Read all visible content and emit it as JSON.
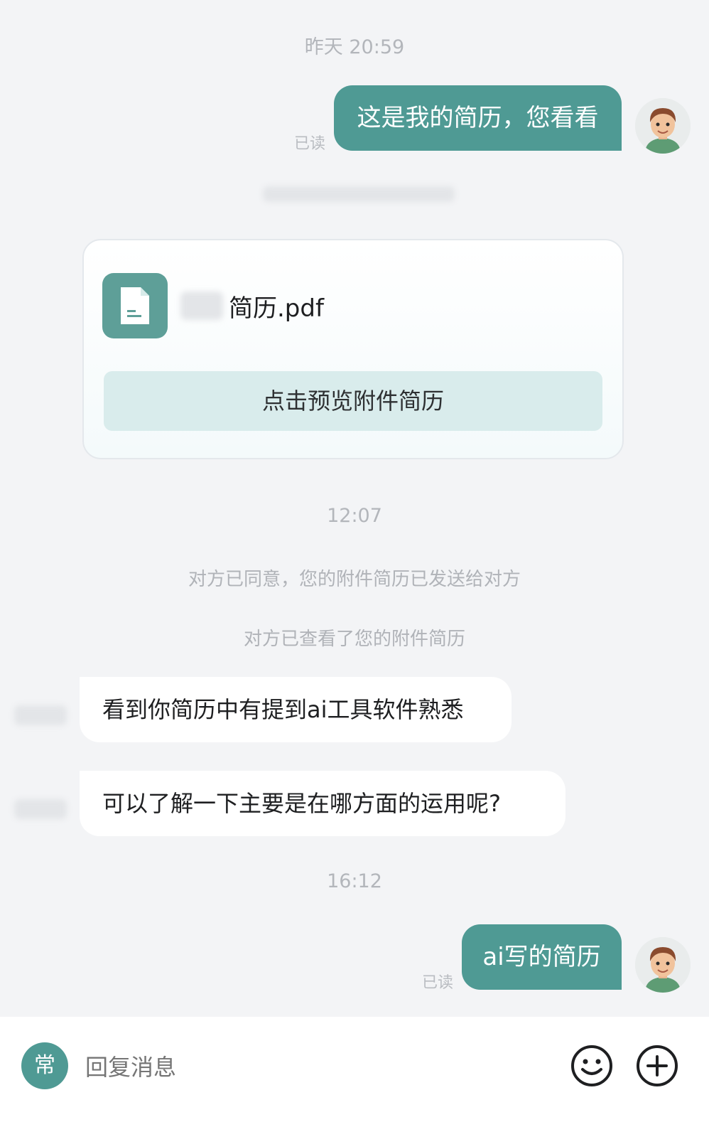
{
  "conversation": {
    "time_1": "昨天 20:59",
    "msg_1": "这是我的简历，您看看",
    "read_1": "已读",
    "attachment": {
      "file_name": "简历.pdf",
      "preview_button": "点击预览附件简历"
    },
    "time_2": "12:07",
    "system_1": "对方已同意，您的附件简历已发送给对方",
    "system_2": "对方已查看了您的附件简历",
    "incoming_1": "看到你简历中有提到ai工具软件熟悉",
    "incoming_2": "可以了解一下主要是在哪方面的运用呢?",
    "time_3": "16:12",
    "msg_2": "ai写的简历",
    "read_2": "已读"
  },
  "input_bar": {
    "quick_reply_badge": "常",
    "placeholder": "回复消息"
  },
  "colors": {
    "accent": "#4f9a94",
    "background": "#f3f4f6",
    "preview_button_bg": "#d9ecec"
  },
  "icons": [
    "file-icon",
    "emoji-icon",
    "plus-icon",
    "avatar"
  ]
}
